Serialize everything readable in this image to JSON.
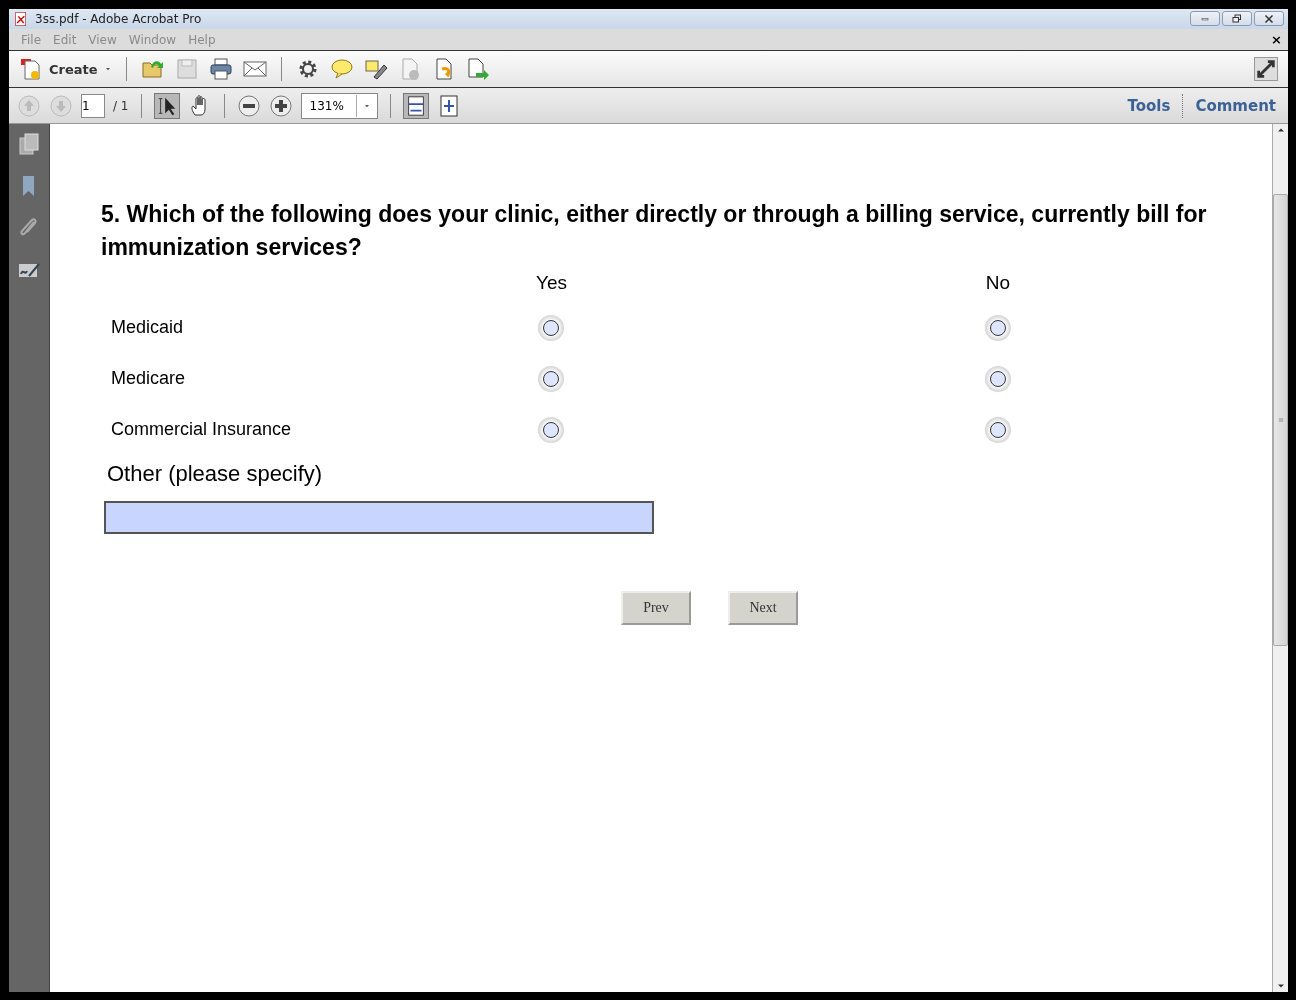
{
  "window": {
    "title": "3ss.pdf - Adobe Acrobat Pro"
  },
  "menu": {
    "items": [
      "File",
      "Edit",
      "View",
      "Window",
      "Help"
    ],
    "close": "×"
  },
  "toolbar": {
    "create_label": "Create"
  },
  "nav": {
    "page": "1",
    "page_total": "/ 1",
    "zoom": "131%"
  },
  "panels": [
    "Tools",
    "Comment"
  ],
  "form": {
    "question": "5. Which of the following does your clinic, either directly or through a billing service, currently bill for immunization services?",
    "columns": [
      "Yes",
      "No"
    ],
    "rows": [
      {
        "label": "Medicaid",
        "choices": [
          {
            "selected": false
          },
          {
            "selected": false
          }
        ]
      },
      {
        "label": "Medicare",
        "choices": [
          {
            "selected": false
          },
          {
            "selected": false
          }
        ]
      },
      {
        "label": "Commercial Insurance",
        "choices": [
          {
            "selected": false
          },
          {
            "selected": false
          }
        ]
      }
    ],
    "other_label": "Other (please specify)",
    "buttons": [
      "Prev",
      "Next"
    ]
  }
}
